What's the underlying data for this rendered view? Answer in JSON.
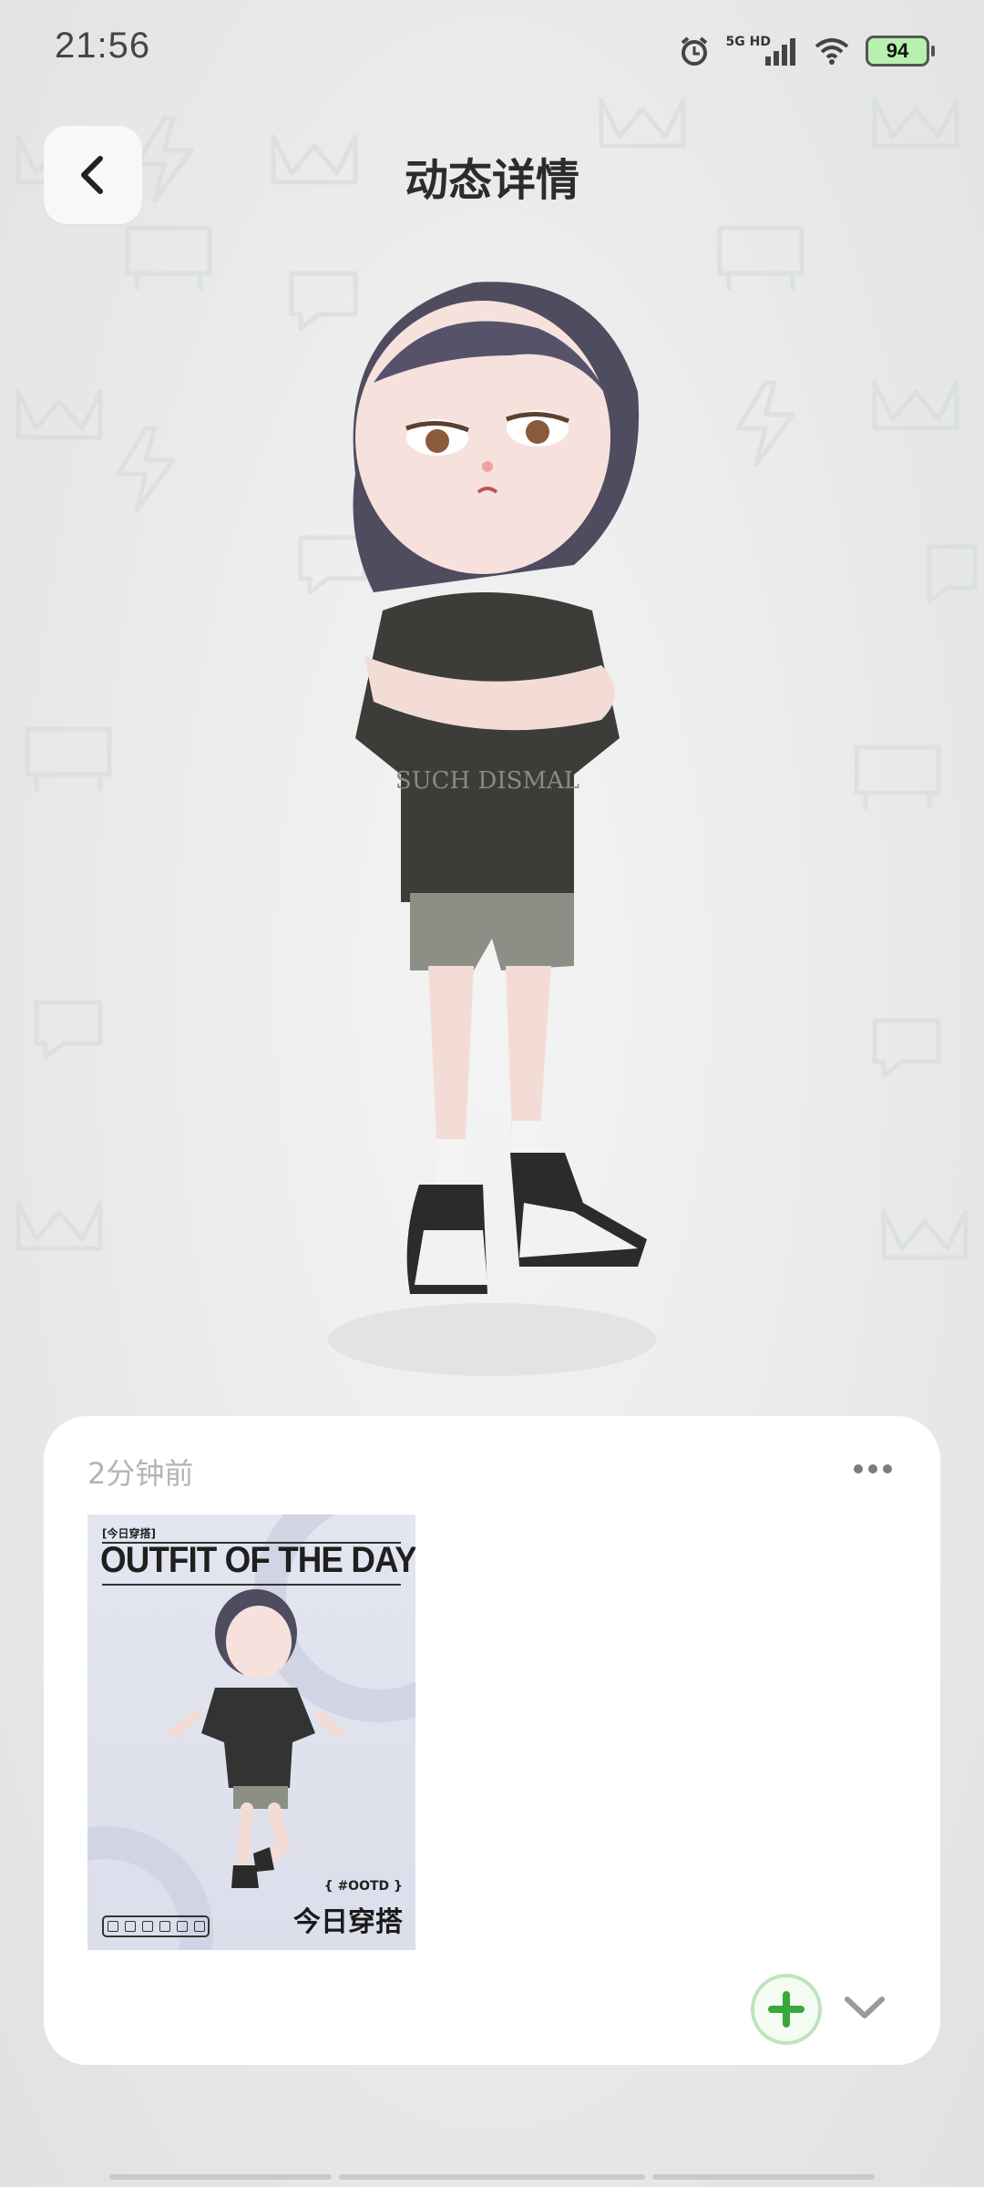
{
  "status_bar": {
    "time": "21:56",
    "network_label": "5G HD",
    "battery": "94",
    "icons": [
      "alarm-icon",
      "signal-icon",
      "wifi-icon",
      "battery-icon"
    ]
  },
  "header": {
    "title": "动态详情",
    "back_icon": "chevron-left-icon"
  },
  "post": {
    "timestamp": "2分钟前",
    "more_icon": "more-horizontal-icon",
    "image": {
      "tag": "[今日穿搭]",
      "heading": "OUTFIT OF THE DAY",
      "hashtag": "{ #OOTD }",
      "caption": "今日穿搭"
    },
    "add_icon": "plus-icon",
    "expand_icon": "chevron-down-icon"
  },
  "colors": {
    "accent_green": "#3aa83a",
    "card_bg": "#ffffff",
    "page_bg": "#eceeed"
  }
}
